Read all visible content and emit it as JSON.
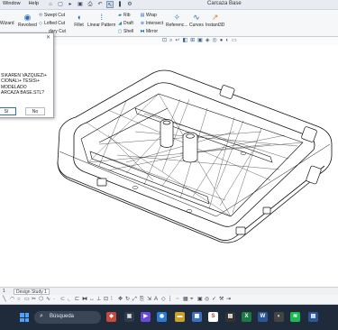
{
  "titlebar": {
    "menu": [
      "Window",
      "Help"
    ],
    "document_title": "Carcaza Base",
    "quick_icons": [
      "home-icon",
      "new-icon",
      "open-icon",
      "save-icon",
      "print-icon",
      "undo-icon",
      "select-icon",
      "rebuild-icon",
      "options-icon"
    ]
  },
  "ribbon": {
    "wizard": "Wizard",
    "revolved": "Revolved",
    "swept_cut": "Swept Cut",
    "lofted_cut": "Lofted Cut",
    "boundary_cut": "dary Cut",
    "fillet": "Fillet",
    "linear_pattern": "Linear Pattern",
    "rib": "Rib",
    "draft": "Draft",
    "shell": "Shell",
    "wrap": "Wrap",
    "intersect": "Intersect",
    "mirror": "Mirror",
    "reference": "Referenc...",
    "curves": "Curves",
    "instant3d": "Instant3D"
  },
  "dialog": {
    "lines": [
      "S\\KAREN VAZQUEZ\\+",
      "CIONAL\\+ TESIS\\+",
      "MODELADO",
      "ARCAZA BASE.STL?"
    ],
    "yes_label": "Sí",
    "no_label": "No"
  },
  "study_tabs": {
    "first": "1",
    "study": "Design Study 1"
  },
  "taskbar": {
    "search_label": "Búsqueda"
  },
  "colors": {
    "taskbar_bg": "#1f2a3a",
    "accent": "#2b6cb8"
  }
}
